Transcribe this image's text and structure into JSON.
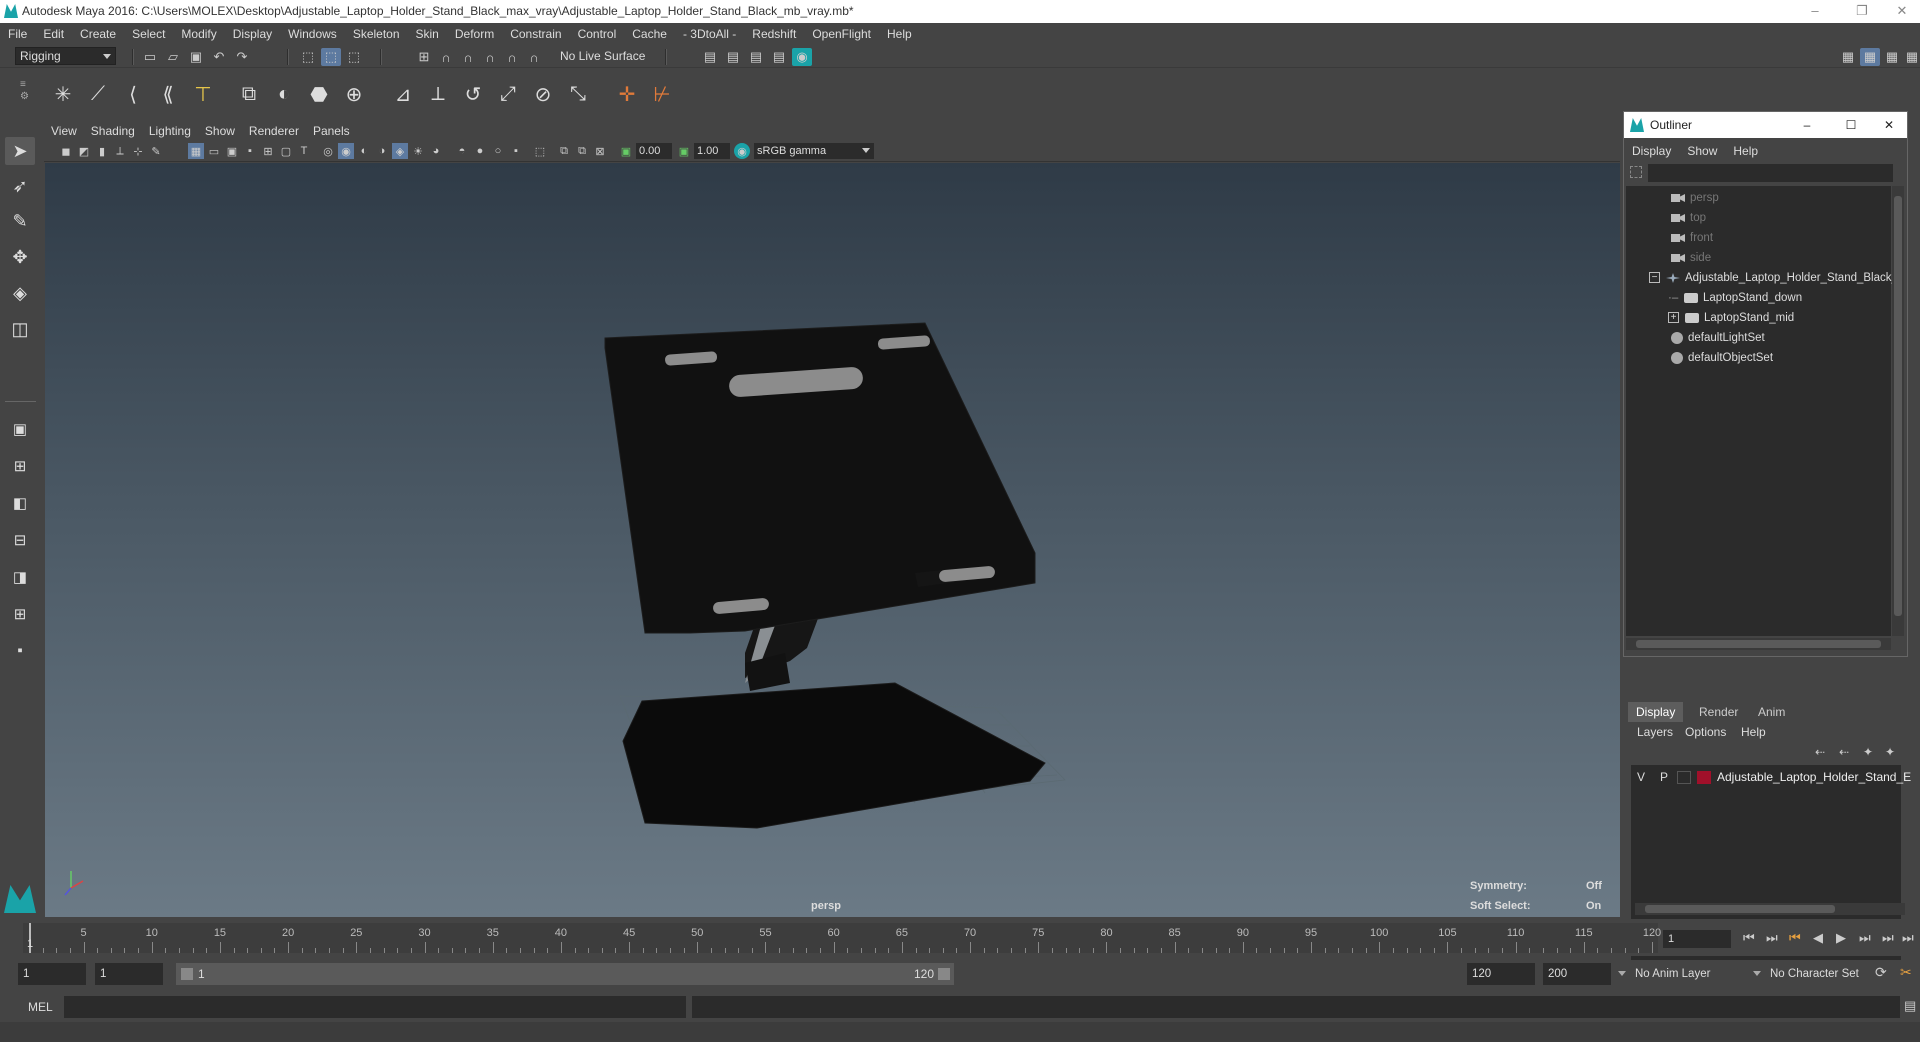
{
  "window": {
    "title": "Autodesk Maya 2016: C:\\Users\\MOLEX\\Desktop\\Adjustable_Laptop_Holder_Stand_Black_max_vray\\Adjustable_Laptop_Holder_Stand_Black_mb_vray.mb*"
  },
  "menubar": [
    "File",
    "Edit",
    "Create",
    "Select",
    "Modify",
    "Display",
    "Windows",
    "Skeleton",
    "Skin",
    "Deform",
    "Constrain",
    "Control",
    "Cache",
    "- 3DtoAll -",
    "Redshift",
    "OpenFlight",
    "Help"
  ],
  "shelf": {
    "mode": "Rigging",
    "live_surface": "No Live Surface"
  },
  "viewport": {
    "menu": [
      "View",
      "Shading",
      "Lighting",
      "Show",
      "Renderer",
      "Panels"
    ],
    "exposure": "0.00",
    "gamma": "1.00",
    "colorspace": "sRGB gamma",
    "camera_label": "persp",
    "symmetry_label": "Symmetry:",
    "symmetry_value": "Off",
    "softselect_label": "Soft Select:",
    "softselect_value": "On"
  },
  "outliner": {
    "title": "Outliner",
    "menu": [
      "Display",
      "Show",
      "Help"
    ],
    "items": [
      {
        "label": "persp",
        "icon": "camera-icon",
        "dim": true
      },
      {
        "label": "top",
        "icon": "camera-icon",
        "dim": true
      },
      {
        "label": "front",
        "icon": "camera-icon",
        "dim": true
      },
      {
        "label": "side",
        "icon": "camera-icon",
        "dim": true
      },
      {
        "label": "Adjustable_Laptop_Holder_Stand_Black_",
        "icon": "group-icon",
        "dim": false
      },
      {
        "label": "LaptopStand_down",
        "icon": "mesh-icon",
        "dim": false
      },
      {
        "label": "LaptopStand_mid",
        "icon": "mesh-icon",
        "dim": false
      },
      {
        "label": "defaultLightSet",
        "icon": "set-icon",
        "dim": false
      },
      {
        "label": "defaultObjectSet",
        "icon": "set-icon",
        "dim": false
      }
    ]
  },
  "layers": {
    "tabs": [
      "Display",
      "Render",
      "Anim"
    ],
    "menu": [
      "Layers",
      "Options",
      "Help"
    ],
    "row": {
      "v": "V",
      "p": "P",
      "name": "Adjustable_Laptop_Holder_Stand_E",
      "color": "#a0102a"
    }
  },
  "timeline": {
    "ticks": [
      5,
      10,
      15,
      20,
      25,
      30,
      35,
      40,
      45,
      50,
      55,
      60,
      65,
      70,
      75,
      80,
      85,
      90,
      95,
      100,
      105,
      110,
      115,
      120
    ],
    "start_label": "1",
    "current_frame": "1"
  },
  "range": {
    "start": "1",
    "anim_start": "1",
    "slider_start": "1",
    "slider_end": "120",
    "playback_end": "120",
    "anim_end": "200",
    "anim_layer": "No Anim Layer",
    "character_set": "No Character Set"
  },
  "command": {
    "lang": "MEL"
  },
  "colors": {
    "accent": "#5d7aa0",
    "maya_teal": "#1aa3a8",
    "layer_red": "#a0102a"
  }
}
